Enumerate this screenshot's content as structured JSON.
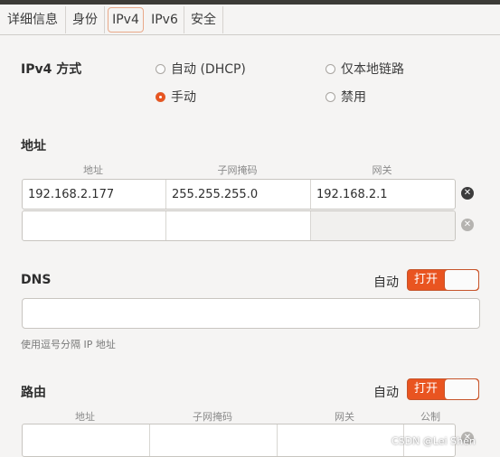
{
  "tabs": [
    {
      "label": "详细信息"
    },
    {
      "label": "身份"
    },
    {
      "label": "IPv4"
    },
    {
      "label": "IPv6"
    },
    {
      "label": "安全"
    }
  ],
  "ipv4_method": {
    "label": "IPv4 方式",
    "options": {
      "auto_dhcp": "自动 (DHCP)",
      "link_local": "仅本地链路",
      "manual": "手动",
      "disabled": "禁用"
    },
    "selected": "手动"
  },
  "address": {
    "section_title": "地址",
    "headers": {
      "address": "地址",
      "netmask": "子网掩码",
      "gateway": "网关"
    },
    "rows": [
      {
        "address": "192.168.2.177",
        "netmask": "255.255.255.0",
        "gateway": "192.168.2.1"
      },
      {
        "address": "",
        "netmask": "",
        "gateway": ""
      }
    ]
  },
  "dns": {
    "title": "DNS",
    "auto_label": "自动",
    "switch_label": "打开",
    "value": "",
    "hint": "使用逗号分隔 IP 地址"
  },
  "routes": {
    "title": "路由",
    "auto_label": "自动",
    "switch_label": "打开",
    "headers": {
      "address": "地址",
      "netmask": "子网掩码",
      "gateway": "网关",
      "metric": "公制"
    }
  },
  "icons": {
    "remove": "close-circle-icon"
  },
  "colors": {
    "accent": "#e95420",
    "remove_dark": "#3c3c3c",
    "remove_light": "#b5b3b0"
  },
  "watermark": "CSDN @Lei Shen"
}
